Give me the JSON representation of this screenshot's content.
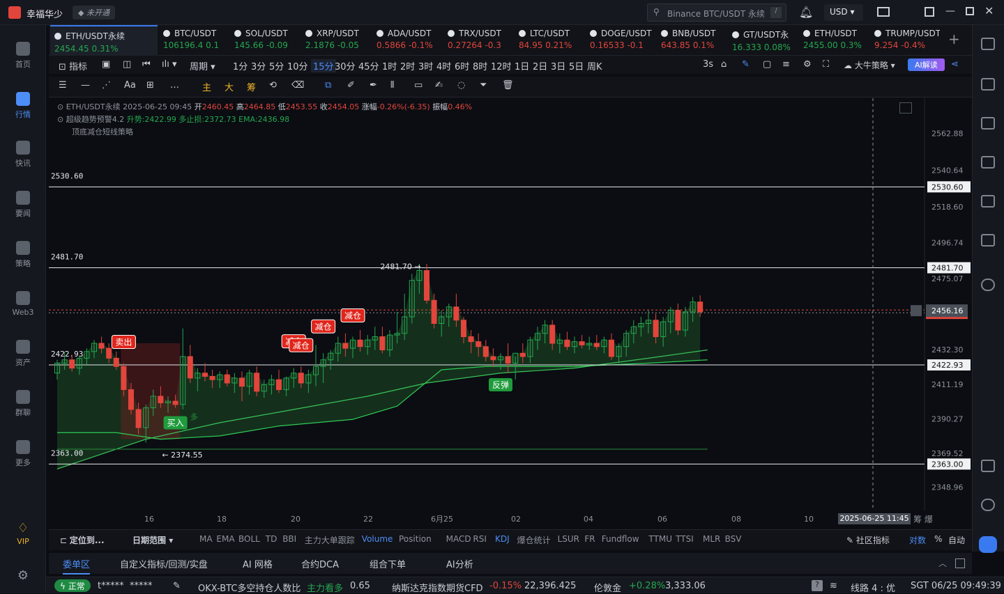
{
  "app": {
    "name": "幸福华少",
    "badge": "未开通",
    "search_placeholder": "Binance BTC/USDT 永续",
    "search_key": "/",
    "currency": "USD"
  },
  "sidebar": {
    "items": [
      {
        "label": "首页",
        "icon": "home-icon"
      },
      {
        "label": "行情",
        "icon": "chart-bars-icon",
        "active": true
      },
      {
        "label": "快讯",
        "icon": "news-icon"
      },
      {
        "label": "要闻",
        "icon": "headline-icon"
      },
      {
        "label": "策略",
        "icon": "robot-icon"
      },
      {
        "label": "Web3",
        "icon": "web3-icon"
      },
      {
        "label": "资产",
        "icon": "wallet-icon"
      },
      {
        "label": "群聊",
        "icon": "chat-icon"
      },
      {
        "label": "更多",
        "icon": "grid-icon"
      }
    ],
    "vip": "VIP"
  },
  "tabs": [
    {
      "symbol": "ETH/USDT永续",
      "price": "2454.45",
      "change": "0.31%",
      "dir": "up",
      "active": true
    },
    {
      "symbol": "BTC/USDT",
      "price": "106196.4",
      "change": "0.1",
      "dir": "up"
    },
    {
      "symbol": "SOL/USDT",
      "price": "145.66",
      "change": "-0.09",
      "dir": "up"
    },
    {
      "symbol": "XRP/USDT",
      "price": "2.1876",
      "change": "-0.05",
      "dir": "up"
    },
    {
      "symbol": "ADA/USDT",
      "price": "0.5866",
      "change": "-0.1%",
      "dir": "dn"
    },
    {
      "symbol": "TRX/USDT",
      "price": "0.27264",
      "change": "-0.3",
      "dir": "dn"
    },
    {
      "symbol": "LTC/USDT",
      "price": "84.95",
      "change": "0.21%",
      "dir": "dn"
    },
    {
      "symbol": "DOGE/USDT",
      "price": "0.16533",
      "change": "-0.1",
      "dir": "dn"
    },
    {
      "symbol": "BNB/USDT",
      "price": "643.85",
      "change": "0.1%",
      "dir": "dn"
    },
    {
      "symbol": "GT/USDT永",
      "price": "16.333",
      "change": "0.08%",
      "dir": "up"
    },
    {
      "symbol": "ETH/USDT",
      "price": "2455.00",
      "change": "0.3%",
      "dir": "up"
    },
    {
      "symbol": "TRUMP/USDT",
      "price": "9.254",
      "change": "-0.4%",
      "dir": "dn"
    }
  ],
  "intervals": {
    "indicator": "指标",
    "period": "周期",
    "items": [
      "1分",
      "3分",
      "5分",
      "10分",
      "15分",
      "30分",
      "45分",
      "1时",
      "2时",
      "3时",
      "4时",
      "6时",
      "8时",
      "12时",
      "1日",
      "2日",
      "3日",
      "5日",
      "周K"
    ],
    "active": "15分",
    "refresh": "3s",
    "strategy": "大牛策略",
    "ai": "AI解读"
  },
  "drawbar": {
    "font": "Aa",
    "ma": "主",
    "da": "大",
    "chou": "筹"
  },
  "legend": {
    "line1": {
      "name": "ETH/USDT永续",
      "time": "2025-06-25 09:45",
      "o_label": "开",
      "o": "2460.45",
      "h_label": "高",
      "h": "2464.85",
      "l_label": "低",
      "l": "2453.55",
      "c_label": "收",
      "c": "2454.05",
      "chg_label": "涨幅",
      "chg": "-0.26%(-6.35)",
      "amp_label": "振幅",
      "amp": "0.46%"
    },
    "line2": {
      "name": "超级趋势预警4.2",
      "a": "升势:2422.99",
      "b": "多止损:2372.73",
      "c": "EMA:2436.98"
    },
    "line3": {
      "name": "顶底减仓短线策略"
    }
  },
  "chart_data": {
    "type": "candlestick",
    "y_ticks": [
      "2562.88",
      "2540.64",
      "2518.60",
      "2496.74",
      "2475.07",
      "2432.30",
      "2411.19",
      "2390.27",
      "2369.52",
      "2348.96"
    ],
    "ylim": [
      2340,
      2580
    ],
    "x_ticks": [
      "16",
      "18",
      "20",
      "22",
      "6月25",
      "02",
      "04",
      "06",
      "08",
      "10"
    ],
    "crosshair_time": "2025-06-25 11:45",
    "current_price": "2456.16",
    "levels": [
      {
        "value": 2530.6,
        "label": "2530.60"
      },
      {
        "value": 2481.7,
        "label": "2481.70"
      },
      {
        "value": 2422.93,
        "label": "2422.93"
      },
      {
        "value": 2363.0,
        "label": "2363.00"
      }
    ],
    "candles": [
      [
        2418,
        2426,
        2414,
        2424
      ],
      [
        2424,
        2431,
        2420,
        2426
      ],
      [
        2426,
        2429,
        2419,
        2421
      ],
      [
        2421,
        2428,
        2417,
        2427
      ],
      [
        2427,
        2433,
        2423,
        2431
      ],
      [
        2431,
        2438,
        2427,
        2436
      ],
      [
        2436,
        2440,
        2430,
        2433
      ],
      [
        2433,
        2436,
        2424,
        2427
      ],
      [
        2427,
        2431,
        2420,
        2422
      ],
      [
        2422,
        2424,
        2404,
        2408
      ],
      [
        2408,
        2412,
        2393,
        2396
      ],
      [
        2396,
        2400,
        2381,
        2385
      ],
      [
        2385,
        2399,
        2376,
        2397
      ],
      [
        2397,
        2408,
        2392,
        2404
      ],
      [
        2404,
        2410,
        2397,
        2400
      ],
      [
        2400,
        2404,
        2394,
        2401
      ],
      [
        2401,
        2405,
        2397,
        2399
      ],
      [
        2399,
        2445,
        2396,
        2428
      ],
      [
        2428,
        2435,
        2412,
        2415
      ],
      [
        2415,
        2421,
        2407,
        2418
      ],
      [
        2418,
        2424,
        2413,
        2416
      ],
      [
        2416,
        2420,
        2409,
        2414
      ],
      [
        2414,
        2419,
        2409,
        2417
      ],
      [
        2417,
        2420,
        2410,
        2412
      ],
      [
        2412,
        2418,
        2406,
        2415
      ],
      [
        2415,
        2419,
        2401,
        2410
      ],
      [
        2410,
        2420,
        2405,
        2418
      ],
      [
        2418,
        2422,
        2404,
        2407
      ],
      [
        2407,
        2414,
        2403,
        2411
      ],
      [
        2411,
        2417,
        2405,
        2414
      ],
      [
        2414,
        2420,
        2406,
        2408
      ],
      [
        2408,
        2416,
        2404,
        2415
      ],
      [
        2415,
        2421,
        2409,
        2418
      ],
      [
        2418,
        2422,
        2409,
        2412
      ],
      [
        2412,
        2420,
        2406,
        2417
      ],
      [
        2417,
        2435,
        2410,
        2422
      ],
      [
        2422,
        2430,
        2412,
        2426
      ],
      [
        2426,
        2432,
        2420,
        2430
      ],
      [
        2430,
        2440,
        2425,
        2436
      ],
      [
        2436,
        2442,
        2428,
        2433
      ],
      [
        2433,
        2440,
        2427,
        2438
      ],
      [
        2438,
        2444,
        2431,
        2434
      ],
      [
        2434,
        2441,
        2429,
        2438
      ],
      [
        2438,
        2446,
        2432,
        2440
      ],
      [
        2440,
        2446,
        2430,
        2432
      ],
      [
        2432,
        2444,
        2428,
        2441
      ],
      [
        2441,
        2455,
        2436,
        2442
      ],
      [
        2442,
        2466,
        2438,
        2452
      ],
      [
        2452,
        2478,
        2448,
        2474
      ],
      [
        2474,
        2484,
        2466,
        2480
      ],
      [
        2480,
        2484,
        2460,
        2462
      ],
      [
        2462,
        2466,
        2445,
        2448
      ],
      [
        2448,
        2456,
        2440,
        2452
      ],
      [
        2452,
        2460,
        2446,
        2458
      ],
      [
        2458,
        2466,
        2446,
        2450
      ],
      [
        2450,
        2452,
        2436,
        2440
      ],
      [
        2440,
        2444,
        2430,
        2437
      ],
      [
        2437,
        2442,
        2428,
        2434
      ],
      [
        2434,
        2438,
        2425,
        2428
      ],
      [
        2428,
        2433,
        2422,
        2426
      ],
      [
        2426,
        2430,
        2420,
        2428
      ],
      [
        2428,
        2436,
        2418,
        2424
      ],
      [
        2424,
        2428,
        2414,
        2430
      ],
      [
        2430,
        2436,
        2424,
        2428
      ],
      [
        2428,
        2440,
        2424,
        2438
      ],
      [
        2438,
        2446,
        2432,
        2442
      ],
      [
        2442,
        2450,
        2436,
        2447
      ],
      [
        2447,
        2450,
        2432,
        2436
      ],
      [
        2436,
        2442,
        2430,
        2438
      ],
      [
        2438,
        2443,
        2432,
        2434
      ],
      [
        2434,
        2440,
        2430,
        2437
      ],
      [
        2437,
        2441,
        2433,
        2435
      ],
      [
        2435,
        2440,
        2432,
        2436
      ],
      [
        2436,
        2441,
        2432,
        2434
      ],
      [
        2434,
        2440,
        2430,
        2438
      ],
      [
        2438,
        2442,
        2426,
        2428
      ],
      [
        2428,
        2436,
        2424,
        2434
      ],
      [
        2434,
        2444,
        2428,
        2442
      ],
      [
        2442,
        2450,
        2436,
        2446
      ],
      [
        2446,
        2452,
        2440,
        2448
      ],
      [
        2448,
        2456,
        2442,
        2450
      ],
      [
        2450,
        2454,
        2436,
        2440
      ],
      [
        2440,
        2452,
        2434,
        2449
      ],
      [
        2449,
        2458,
        2442,
        2456
      ],
      [
        2456,
        2460,
        2441,
        2444
      ],
      [
        2444,
        2458,
        2440,
        2455
      ],
      [
        2455,
        2464,
        2449,
        2461
      ],
      [
        2461,
        2465,
        2452,
        2455
      ]
    ],
    "supertrend": [
      [
        0,
        2382
      ],
      [
        8,
        2382
      ],
      [
        14,
        2378
      ],
      [
        22,
        2380
      ],
      [
        30,
        2386
      ],
      [
        40,
        2390
      ],
      [
        46,
        2398
      ],
      [
        52,
        2420
      ],
      [
        58,
        2422
      ],
      [
        70,
        2422
      ],
      [
        80,
        2424
      ],
      [
        88,
        2426
      ]
    ],
    "ema": [
      [
        0,
        2360
      ],
      [
        12,
        2378
      ],
      [
        22,
        2388
      ],
      [
        32,
        2396
      ],
      [
        42,
        2404
      ],
      [
        50,
        2412
      ],
      [
        60,
        2418
      ],
      [
        70,
        2421
      ],
      [
        80,
        2427
      ],
      [
        88,
        2432
      ]
    ],
    "signals": [
      {
        "label": "卖出",
        "idx": 9,
        "type": "sell"
      },
      {
        "label": "减仓",
        "idx": 32,
        "type": "sell"
      },
      {
        "label": "减仓",
        "idx": 33,
        "type": "sell"
      },
      {
        "label": "减仓",
        "idx": 36,
        "type": "sell"
      },
      {
        "label": "减仓",
        "idx": 40,
        "type": "sell"
      },
      {
        "label": "买入",
        "idx": 16,
        "type": "buy"
      },
      {
        "label": "反弹",
        "idx": 60,
        "type": "buy"
      }
    ],
    "annotations": [
      {
        "text": "← 2374.55"
      },
      {
        "text": "2481.70 →"
      },
      {
        "text": "多"
      }
    ]
  },
  "bottom": {
    "locate": "定位到...",
    "range": "日期范围",
    "indicators": [
      "MA",
      "EMA",
      "BOLL",
      "TD",
      "BBI",
      "主力大单跟踪",
      "Volume",
      "Position",
      "MACD",
      "RSI",
      "KDJ",
      "爆仓统计",
      "LSUR",
      "FR",
      "Fundflow",
      "TTMU",
      "TTSI",
      "MLR",
      "BSV"
    ],
    "active": [
      "Volume",
      "KDJ"
    ],
    "community": "社区指标",
    "log": "对数",
    "pct": "%",
    "auto": "自动"
  },
  "panel": {
    "tabs": [
      "委单区",
      "自定义指标/回测/实盘",
      "AI 网格",
      "合约DCA",
      "组合下单",
      "AI分析"
    ],
    "active": "委单区"
  },
  "status": {
    "state": "正常",
    "user": "t*****",
    "pwd": "*****",
    "ticker1_name": "OKX-BTC多空持仓人数比",
    "ticker1_tag": "主力看多",
    "ticker1_val": "0.65",
    "ticker2_name": "纳斯达克指数期货CFD",
    "ticker2_chg": "-0.15%",
    "ticker2_val": "22,396.425",
    "ticker3_name": "伦敦金",
    "ticker3_chg": "+0.28%",
    "ticker3_val": "3,333.06",
    "line": "线路 4 : 优",
    "clock": "SGT 06/25 09:49:39",
    "help": "?"
  }
}
